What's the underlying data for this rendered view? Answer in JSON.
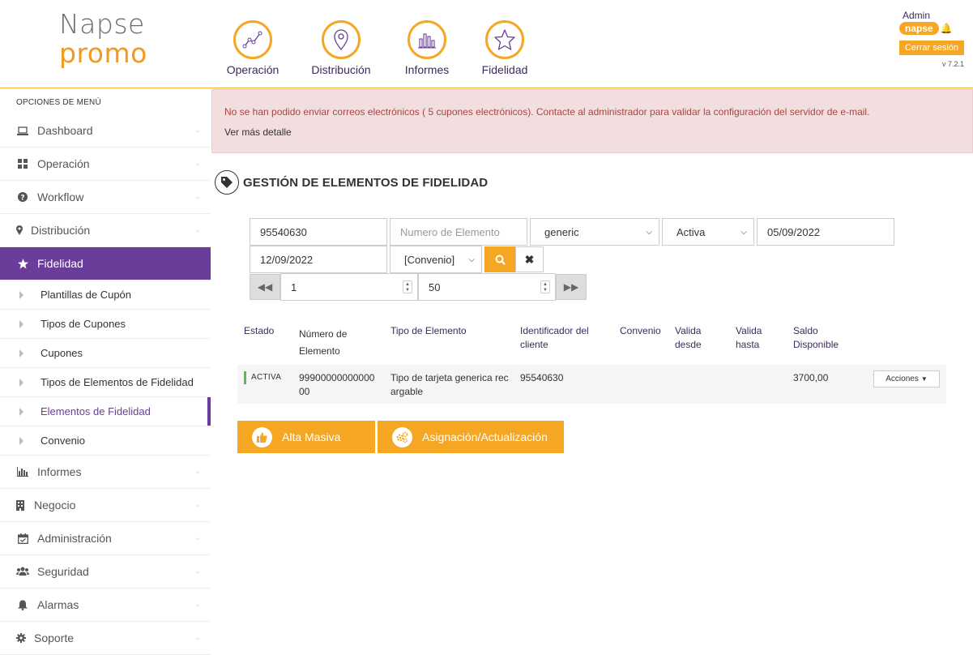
{
  "header": {
    "logo_line1": "Napse",
    "logo_line2": "promo",
    "nav": [
      {
        "label": "Operación",
        "icon": "chart-line-icon"
      },
      {
        "label": "Distribución",
        "icon": "map-pin-icon"
      },
      {
        "label": "Informes",
        "icon": "bar-chart-icon"
      },
      {
        "label": "Fidelidad",
        "icon": "star-icon"
      }
    ],
    "user": "Admin",
    "brand_badge": "napse",
    "logout": "Cerrar sesión",
    "version": "v 7.2.1"
  },
  "sidebar": {
    "title": "OPCIONES DE MENÚ",
    "items": [
      {
        "label": "Dashboard",
        "icon": "laptop-icon"
      },
      {
        "label": "Operación",
        "icon": "grid-icon"
      },
      {
        "label": "Workflow",
        "icon": "question-circle-icon"
      },
      {
        "label": "Distribución",
        "icon": "map-marker-icon"
      },
      {
        "label": "Fidelidad",
        "icon": "star-icon"
      },
      {
        "label": "Informes",
        "icon": "bar-chart-icon"
      },
      {
        "label": "Negocio",
        "icon": "building-icon"
      },
      {
        "label": "Administración",
        "icon": "calendar-check-icon"
      },
      {
        "label": "Seguridad",
        "icon": "users-icon"
      },
      {
        "label": "Alarmas",
        "icon": "bell-icon"
      },
      {
        "label": "Soporte",
        "icon": "gear-icon"
      }
    ],
    "sub_items": [
      {
        "label": "Plantillas de Cupón"
      },
      {
        "label": "Tipos de Cupones"
      },
      {
        "label": "Cupones"
      },
      {
        "label": "Tipos de Elementos de Fidelidad"
      },
      {
        "label": "Elementos de Fidelidad"
      },
      {
        "label": "Convenio"
      }
    ]
  },
  "alert": {
    "message": "No se han podido enviar correos electrónicos ( 5 cupones electrónicos). Contacte al administrador para validar la configuración del servidor de e-mail.",
    "link": "Ver más detalle"
  },
  "page": {
    "title": "GESTIÓN DE ELEMENTOS DE FIDELIDAD"
  },
  "filters": {
    "client_id": "95540630",
    "element_number_placeholder": "Numero de Elemento",
    "type": "generic",
    "status": "Activa",
    "date_from": "05/09/2022",
    "date_to": "12/09/2022",
    "convenio": "[Convenio]",
    "page": "1",
    "page_size": "50"
  },
  "table": {
    "headers": [
      "Estado",
      "Número de Elemento",
      "Tipo de Elemento",
      "Identificador del cliente",
      "Convenio",
      "Valida desde",
      "Valida hasta",
      "Saldo Disponible"
    ],
    "rows": [
      {
        "status": "ACTIVA",
        "number": "9990000000000000",
        "type": "Tipo de tarjeta generica recargable",
        "client": "95540630",
        "convenio": "",
        "from": "",
        "to": "",
        "balance": "3700,00"
      }
    ],
    "actions_label": "Acciones"
  },
  "buttons": {
    "bulk": "Alta Masiva",
    "assign": "Asignación/Actualización"
  },
  "colors": {
    "accent": "#f5a623",
    "purple": "#6a3d9a",
    "alert_bg": "#f2dede",
    "alert_text": "#a94442"
  }
}
